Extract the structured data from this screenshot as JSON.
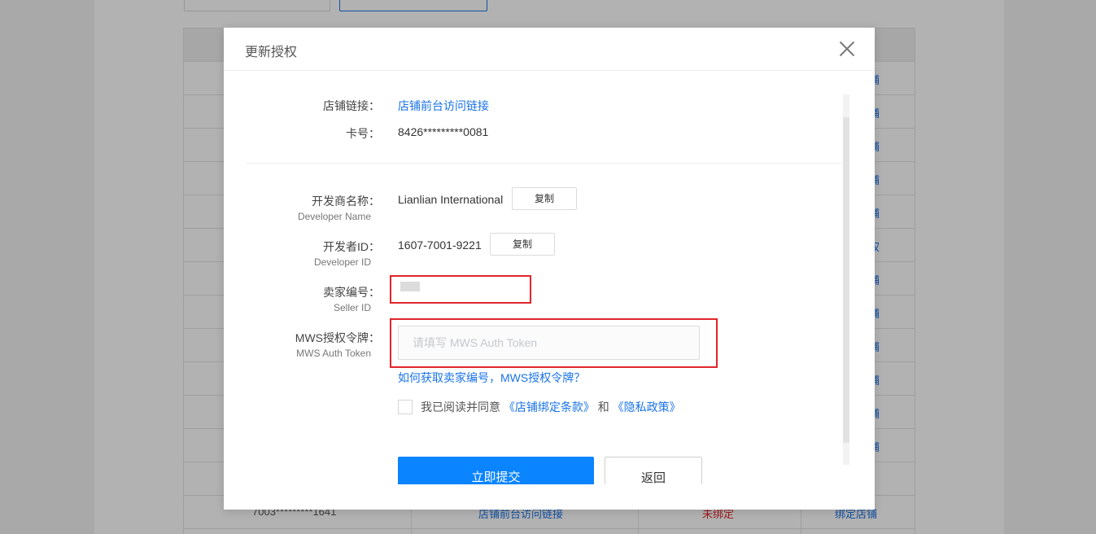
{
  "modal": {
    "title": "更新授权",
    "store_link_label": "店铺链接：",
    "store_link_value": "店铺前台访问链接",
    "card_label": "卡号：",
    "card_value": "8426*********0081",
    "developer_name_label": "开发商名称：",
    "developer_name_sub": "Developer Name",
    "developer_name_value": "Lianlian International",
    "copy_label": "复制",
    "developer_id_label": "开发者ID：",
    "developer_id_sub": "Developer ID",
    "developer_id_value": "1607-7001-9221",
    "seller_id_label": "卖家编号：",
    "seller_id_sub": "Seller ID",
    "mws_label": "MWS授权令牌：",
    "mws_sub": "MWS Auth Token",
    "mws_placeholder": "请填写 MWS Auth Token",
    "mws_value": "",
    "help_link": "如何获取卖家编号，MWS授权令牌？",
    "agree_prefix": "我已阅读并同意",
    "agree_terms": "《店铺绑定条款》",
    "agree_and": "和",
    "agree_privacy": "《隐私政策》",
    "submit_label": "立即提交",
    "back_label": "返回"
  },
  "background": {
    "row_link_text": "铺",
    "row_link_auth": "权",
    "last_row": {
      "card": "7003*********1641",
      "link": "店铺前台访问链接",
      "status": "未绑定",
      "action": "绑定店铺"
    }
  },
  "colors": {
    "primary": "#0a84ff",
    "link": "#1a73e8",
    "highlight_box": "#e0262b",
    "status_unbound": "#e0262b"
  }
}
